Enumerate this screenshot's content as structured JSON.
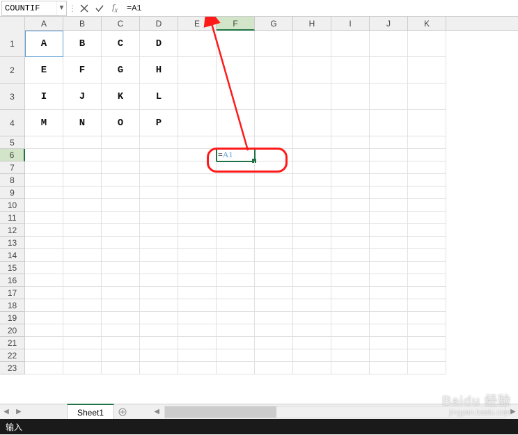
{
  "name_box": {
    "value": "COUNTIF"
  },
  "formula": {
    "value": "=A1"
  },
  "columns": [
    "A",
    "B",
    "C",
    "D",
    "E",
    "F",
    "G",
    "H",
    "I",
    "J",
    "K"
  ],
  "rows_tall": [
    "1",
    "2",
    "3",
    "4"
  ],
  "rows_short": [
    "5",
    "6",
    "7",
    "8",
    "9",
    "10",
    "11",
    "12",
    "13",
    "14",
    "15",
    "16",
    "17",
    "18",
    "19",
    "20",
    "21",
    "22",
    "23"
  ],
  "grid": {
    "r1": {
      "A": "A",
      "B": "B",
      "C": "C",
      "D": "D"
    },
    "r2": {
      "A": "E",
      "B": "F",
      "C": "G",
      "D": "H"
    },
    "r3": {
      "A": "I",
      "B": "J",
      "C": "K",
      "D": "L"
    },
    "r4": {
      "A": "M",
      "B": "N",
      "C": "O",
      "D": "P"
    }
  },
  "editing_cell": {
    "eq": "=",
    "ref": "A1"
  },
  "active_column": "F",
  "active_row": "6",
  "reference_cell": "A1",
  "tabs": {
    "sheet1": "Sheet1"
  },
  "status": {
    "mode": "输入"
  },
  "watermark": {
    "main": "Baidu 经验",
    "sub": "jingyan.baidu.com"
  }
}
